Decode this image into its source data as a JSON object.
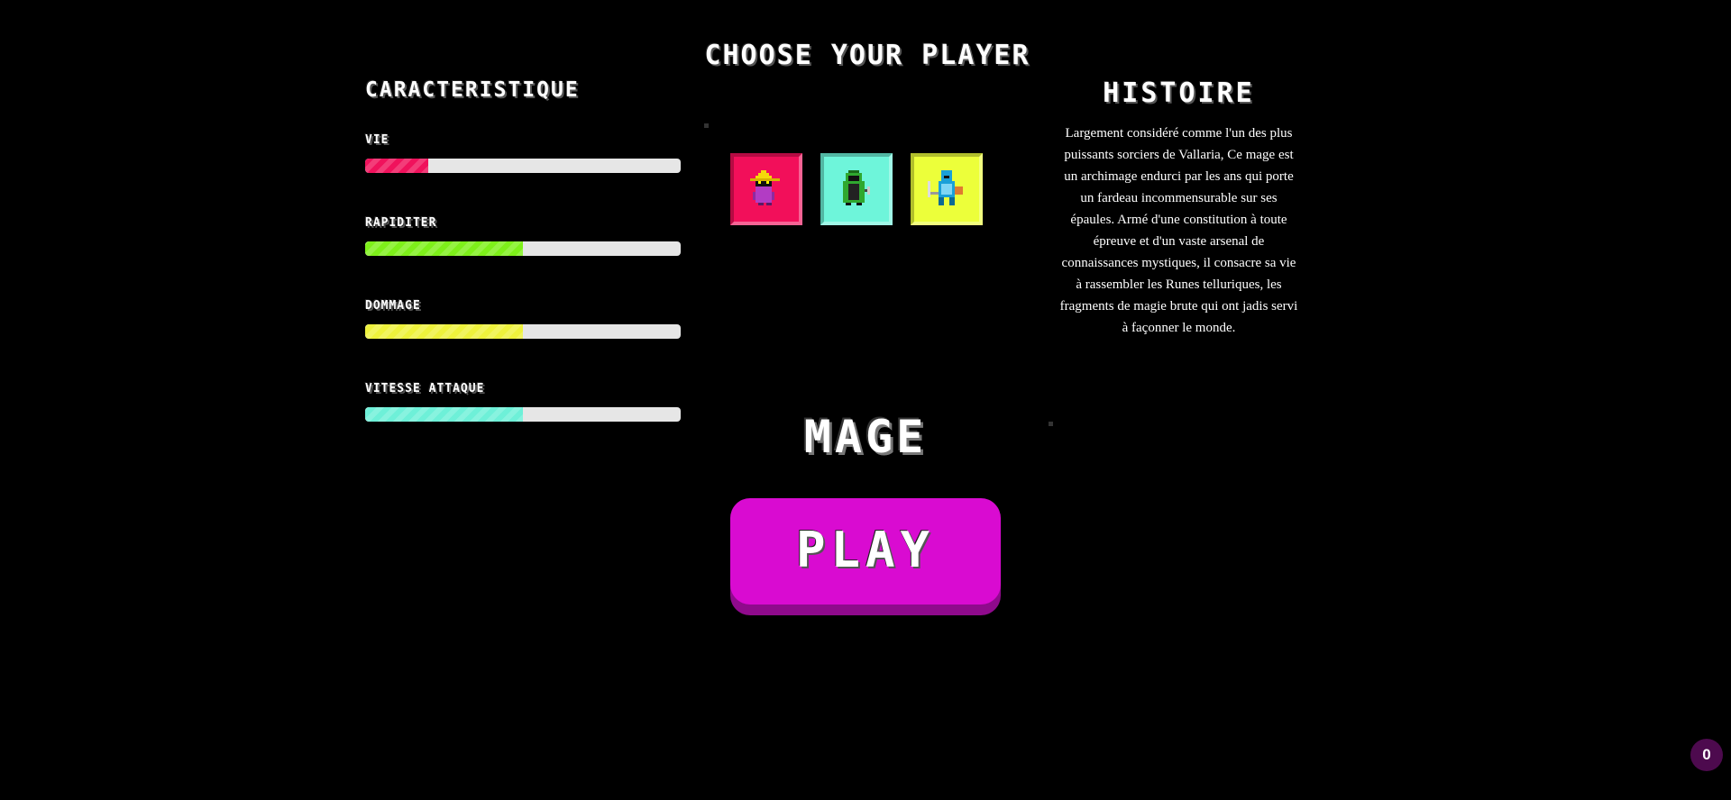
{
  "page": {
    "title": "CHOOSE YOUR PLAYER"
  },
  "stats": {
    "title": "CARACTERISTIQUE",
    "items": [
      {
        "label": "VIE",
        "value": 0.2,
        "color": "#f0125c"
      },
      {
        "label": "RAPIDITER",
        "value": 0.5,
        "color": "#7ef01a"
      },
      {
        "label": "DOMMAGE",
        "value": 0.5,
        "color": "#eef23c"
      },
      {
        "label": "VITESSE ATTAQUE",
        "value": 0.5,
        "color": "#6ef0d8"
      }
    ]
  },
  "characters": [
    {
      "id": "mage",
      "icon": "mage-character-icon",
      "bg": "#f20f5a",
      "selected": true
    },
    {
      "id": "rogue",
      "icon": "rogue-character-icon",
      "bg": "#6ef5da",
      "selected": false
    },
    {
      "id": "knight",
      "icon": "knight-character-icon",
      "bg": "#ecff3a",
      "selected": false
    }
  ],
  "selected_name": "MAGE",
  "play_label": "PLAY",
  "story": {
    "title": "HISTOIRE",
    "text": "Largement considéré comme l'un des plus puissants sorciers de Vallaria, Ce mage est un archimage endurci par les ans qui porte un fardeau incommensurable sur ses épaules. Armé d'une constitution à toute épreuve et d'un vaste arsenal de connaissances mystiques, il consacre sa vie à rassembler les Runes telluriques, les fragments de magie brute qui ont jadis servi à façonner le monde."
  },
  "counter": "0",
  "accent_color": "#d90bd1"
}
